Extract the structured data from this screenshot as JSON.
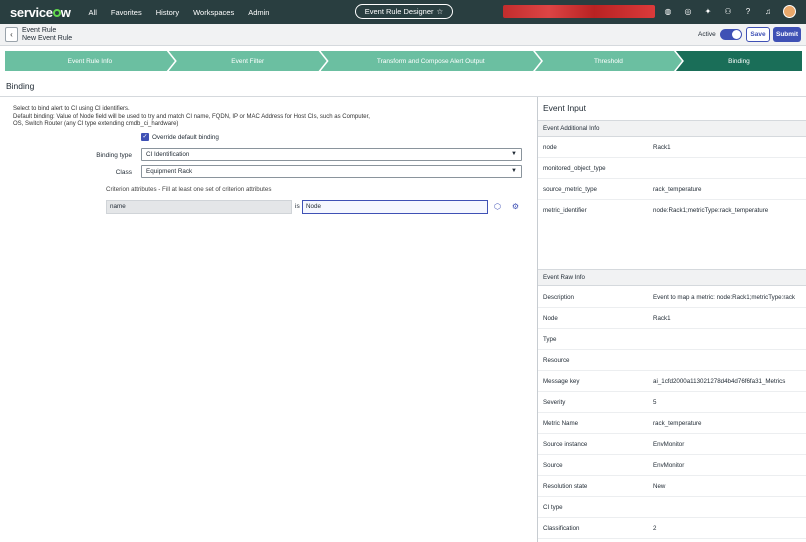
{
  "nav": {
    "logo": "servicenow",
    "menu": [
      "All",
      "Favorites",
      "History",
      "Workspaces",
      "Admin"
    ],
    "center_title": "Event Rule Designer",
    "icons": [
      "globe-icon",
      "help-circle-icon",
      "sparkle-icon",
      "chat-icon",
      "question-icon",
      "bell-icon",
      "avatar"
    ]
  },
  "header": {
    "line1": "Event Rule",
    "line2": "New Event Rule",
    "active_label": "Active",
    "save_label": "Save",
    "submit_label": "Submit"
  },
  "steps": [
    {
      "label": "Event Rule Info"
    },
    {
      "label": "Event Filter"
    },
    {
      "label": "Transform and Compose Alert Output"
    },
    {
      "label": "Threshold"
    },
    {
      "label": "Binding"
    }
  ],
  "section_title": "Binding",
  "binding": {
    "help1": "Select to bind alert to CI using CI identifiers.",
    "help2": "Default binding: Value of Node field will be used to try and match CI name, FQDN, IP or MAC Address for Host CIs, such as Computer,",
    "help3": "OS, Switch Router (any CI type extending cmdb_ci_hardware)",
    "override_label": "Override default binding",
    "binding_type_label": "Binding type",
    "binding_type_value": "CI Identification",
    "class_label": "Class",
    "class_value": "Equipment Rack",
    "criterion_label": "Criterion attributes - Fill at least one set of criterion attributes",
    "criterion_name": "name",
    "criterion_is": "is",
    "criterion_value": "Node"
  },
  "event_input": {
    "title": "Event Input",
    "additional_info_title": "Event Additional Info",
    "additional_info": [
      {
        "k": "node",
        "v": "Rack1"
      },
      {
        "k": "monitored_object_type",
        "v": ""
      },
      {
        "k": "source_metric_type",
        "v": "rack_temperature"
      },
      {
        "k": "metric_identifier",
        "v": "node:Rack1;metricType:rack_temperature"
      }
    ],
    "raw_info_title": "Event Raw Info",
    "raw_info": [
      {
        "k": "Description",
        "v": "Event to map a metric: node:Rack1;metricType:rack"
      },
      {
        "k": "Node",
        "v": "Rack1"
      },
      {
        "k": "Type",
        "v": ""
      },
      {
        "k": "Resource",
        "v": ""
      },
      {
        "k": "Message key",
        "v": "ai_1cfd2000a113021278d4b4d76f6fa31_Metrics"
      },
      {
        "k": "Severity",
        "v": "5"
      },
      {
        "k": "Metric Name",
        "v": "rack_temperature"
      },
      {
        "k": "Source instance",
        "v": "EnvMonitor"
      },
      {
        "k": "Source",
        "v": "EnvMonitor"
      },
      {
        "k": "Resolution state",
        "v": "New"
      },
      {
        "k": "CI type",
        "v": ""
      },
      {
        "k": "Classification",
        "v": "2"
      }
    ]
  }
}
